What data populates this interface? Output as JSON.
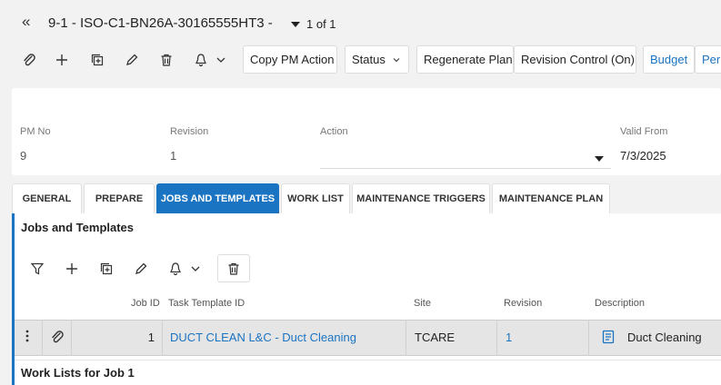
{
  "header": {
    "back_icon": "«",
    "title": "9-1 - ISO-C1-BN26A-30165555HT3 -",
    "record_count": "1 of 1"
  },
  "toolbar": {
    "copy_pm_action": "Copy PM Action",
    "status": "Status",
    "regenerate_plan": "Regenerate Plan",
    "revision_control": "Revision Control (On)",
    "budget": "Budget",
    "overflow": "Perm"
  },
  "fields": {
    "pm_no_label": "PM No",
    "pm_no_value": "9",
    "revision_label": "Revision",
    "revision_value": "1",
    "action_label": "Action",
    "action_value": "",
    "valid_from_label": "Valid From",
    "valid_from_value": "7/3/2025"
  },
  "tabs": [
    {
      "label": "GENERAL"
    },
    {
      "label": "PREPARE"
    },
    {
      "label": "JOBS AND TEMPLATES",
      "active": true
    },
    {
      "label": "WORK LIST"
    },
    {
      "label": "MAINTENANCE TRIGGERS"
    },
    {
      "label": "MAINTENANCE PLAN"
    }
  ],
  "jobs": {
    "section_title": "Jobs and Templates",
    "columns": [
      "Job ID",
      "Task Template ID",
      "Site",
      "Revision",
      "Description"
    ],
    "rows": [
      {
        "job_id": "1",
        "task_template_id": "DUCT CLEAN L&C - Duct Cleaning",
        "site": "TCARE",
        "revision": "1",
        "description": "Duct Cleaning"
      }
    ]
  },
  "work_lists": {
    "section_title": "Work Lists for Job 1"
  },
  "colors": {
    "accent": "#1b74c2",
    "row_selected": "#e5e5e5"
  }
}
